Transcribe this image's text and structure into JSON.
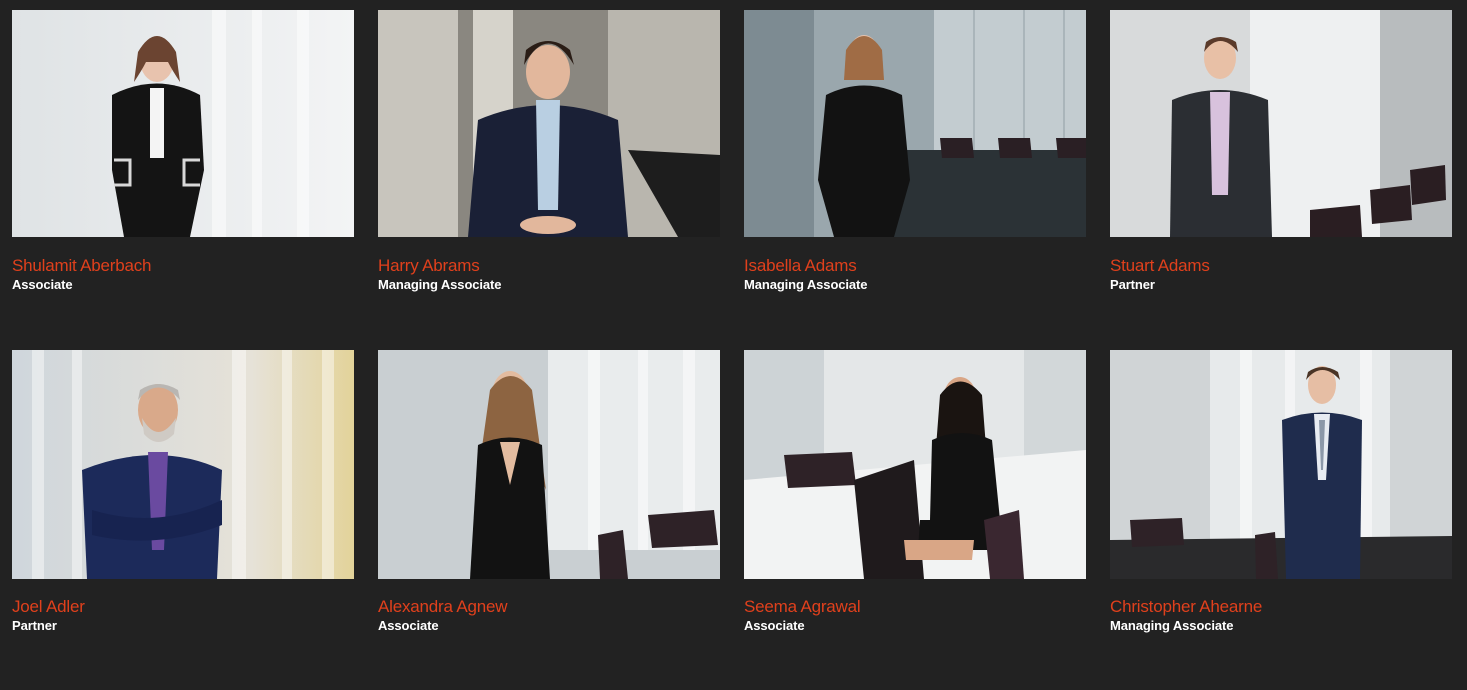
{
  "people": [
    {
      "name": "Shulamit Aberbach",
      "role": "Associate",
      "photo_icon": "person-portrait-icon"
    },
    {
      "name": "Harry Abrams",
      "role": "Managing Associate",
      "photo_icon": "person-portrait-icon"
    },
    {
      "name": "Isabella Adams",
      "role": "Managing Associate",
      "photo_icon": "person-portrait-icon"
    },
    {
      "name": "Stuart Adams",
      "role": "Partner",
      "photo_icon": "person-portrait-icon"
    },
    {
      "name": "Joel Adler",
      "role": "Partner",
      "photo_icon": "person-portrait-icon"
    },
    {
      "name": "Alexandra Agnew",
      "role": "Associate",
      "photo_icon": "person-portrait-icon"
    },
    {
      "name": "Seema Agrawal",
      "role": "Associate",
      "photo_icon": "person-portrait-icon"
    },
    {
      "name": "Christopher Ahearne",
      "role": "Managing Associate",
      "photo_icon": "person-portrait-icon"
    }
  ],
  "colors": {
    "background": "#222222",
    "name_accent": "#e0401c",
    "role_text": "#ffffff"
  }
}
